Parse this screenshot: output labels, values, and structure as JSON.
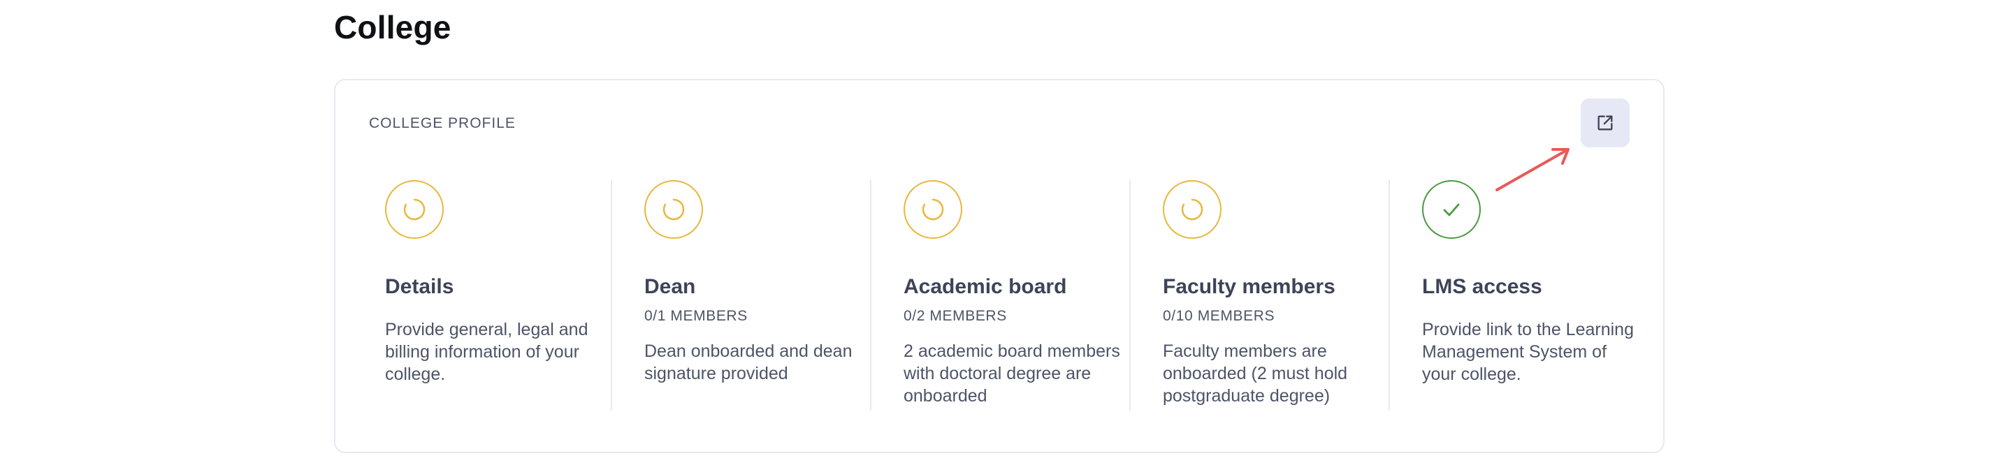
{
  "page": {
    "title": "College"
  },
  "card": {
    "label": "COLLEGE PROFILE",
    "open_button_icon": "external-link-icon"
  },
  "steps": [
    {
      "status": "pending",
      "icon": "spinner-icon",
      "title": "Details",
      "subtitle": "",
      "description": "Provide general, legal and billing information of your college."
    },
    {
      "status": "pending",
      "icon": "spinner-icon",
      "title": "Dean",
      "subtitle": "0/1 MEMBERS",
      "description": "Dean onboarded and dean signature provided"
    },
    {
      "status": "pending",
      "icon": "spinner-icon",
      "title": "Academic board",
      "subtitle": "0/2 MEMBERS",
      "description": "2 academic board members with doctoral degree are onboarded"
    },
    {
      "status": "pending",
      "icon": "spinner-icon",
      "title": "Faculty members",
      "subtitle": "0/10 MEMBERS",
      "description": "Faculty members are onboarded (2 must hold postgraduate degree)"
    },
    {
      "status": "done",
      "icon": "check-icon",
      "title": "LMS access",
      "subtitle": "",
      "description": "Provide link to the Learning Management System of your college."
    }
  ],
  "colors": {
    "pending": "#e8b83c",
    "done": "#4a9a3f",
    "annotation_arrow": "#e85a57",
    "button_bg": "#e6e9f5"
  }
}
